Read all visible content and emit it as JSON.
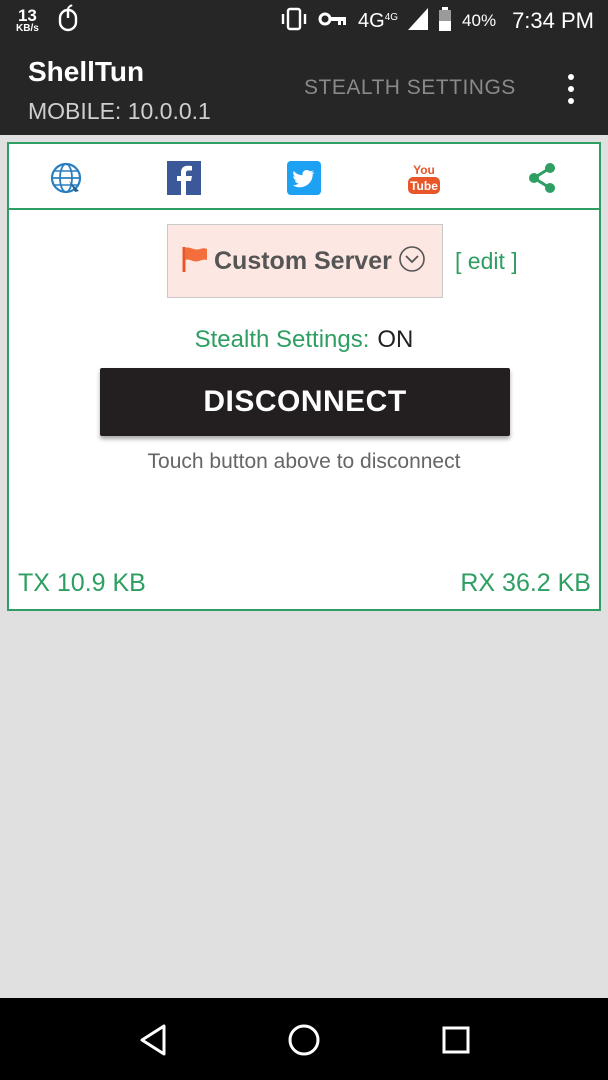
{
  "status_bar": {
    "net_speed": "13",
    "net_unit": "KB/s",
    "network": "4G",
    "network_sup": "4G",
    "battery": "40%",
    "time": "7:34 PM"
  },
  "app_bar": {
    "title": "ShellTun",
    "subtitle": "MOBILE: 10.0.0.1",
    "stealth_action": "STEALTH SETTINGS"
  },
  "social": [
    "globe-icon",
    "facebook-icon",
    "twitter-icon",
    "youtube-icon",
    "share-icon"
  ],
  "server": {
    "label": "Custom Server",
    "edit": "[ edit ]"
  },
  "stealth": {
    "label": "Stealth Settings:",
    "value": "ON"
  },
  "connection": {
    "button": "DISCONNECT",
    "hint": "Touch button above to disconnect"
  },
  "traffic": {
    "tx": "TX 10.9 KB",
    "rx": "RX 36.2 KB"
  },
  "colors": {
    "accent_green": "#2e9e62",
    "appbar": "#262626",
    "facebook": "#3b5998",
    "twitter": "#1da1f2",
    "youtube": "#e8572a"
  }
}
